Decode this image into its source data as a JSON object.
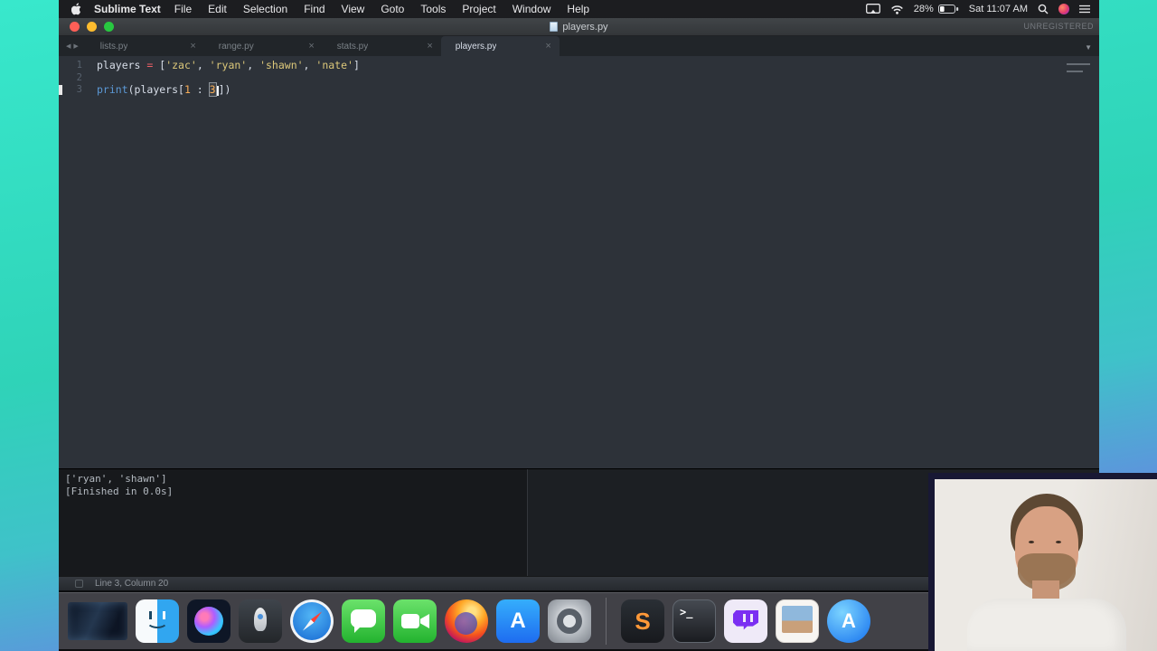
{
  "menu_bar": {
    "app_name": "Sublime Text",
    "items": [
      "File",
      "Edit",
      "Selection",
      "Find",
      "View",
      "Goto",
      "Tools",
      "Project",
      "Window",
      "Help"
    ],
    "battery": "28%",
    "datetime": "Sat 11:07 AM"
  },
  "window": {
    "title": "players.py",
    "registration": "UNREGISTERED",
    "tab_close_glyph": "×",
    "tab_nav_back": "◀",
    "tab_nav_forward": "▶",
    "tab_overflow_glyph": "▼",
    "tabs": [
      {
        "label": "lists.py",
        "active": false
      },
      {
        "label": "range.py",
        "active": false
      },
      {
        "label": "stats.py",
        "active": false
      },
      {
        "label": "players.py",
        "active": true
      }
    ]
  },
  "editor": {
    "lines": [
      {
        "num": "1",
        "caret": false,
        "segments": [
          {
            "t": "players ",
            "c": "fg"
          },
          {
            "t": "=",
            "c": "kw"
          },
          {
            "t": " [",
            "c": "fg"
          },
          {
            "t": "'zac'",
            "c": "str"
          },
          {
            "t": ", ",
            "c": "fg"
          },
          {
            "t": "'ryan'",
            "c": "str"
          },
          {
            "t": ", ",
            "c": "fg"
          },
          {
            "t": "'shawn'",
            "c": "str"
          },
          {
            "t": ", ",
            "c": "fg"
          },
          {
            "t": "'nate'",
            "c": "str"
          },
          {
            "t": "]",
            "c": "fg"
          }
        ]
      },
      {
        "num": "2",
        "caret": false,
        "segments": []
      },
      {
        "num": "3",
        "caret": true,
        "segments": [
          {
            "t": "print",
            "c": "fn"
          },
          {
            "t": "(players[",
            "c": "fg"
          },
          {
            "t": "1",
            "c": "num"
          },
          {
            "t": " : ",
            "c": "fg"
          },
          {
            "t": "3",
            "c": "num sel"
          },
          {
            "caret": true
          },
          {
            "t": "])",
            "c": "fg"
          }
        ]
      }
    ]
  },
  "console": {
    "lines": [
      "['ryan', 'shawn']",
      "[Finished in 0.0s]"
    ]
  },
  "status_bar": {
    "position": "Line 3, Column 20"
  },
  "dock": {
    "items": [
      {
        "id": "thumb",
        "name": "minimized-window-thumbnail"
      },
      {
        "id": "finder",
        "name": "finder-icon"
      },
      {
        "id": "siri",
        "name": "siri-icon"
      },
      {
        "id": "launchpad",
        "name": "launchpad-icon"
      },
      {
        "id": "safari",
        "name": "safari-icon"
      },
      {
        "id": "messages",
        "name": "messages-icon"
      },
      {
        "id": "facetime",
        "name": "facetime-icon"
      },
      {
        "id": "firefox",
        "name": "firefox-icon"
      },
      {
        "id": "appstore",
        "name": "app-store-icon",
        "glyph": "A"
      },
      {
        "id": "syspref",
        "name": "system-preferences-icon"
      },
      {
        "id": "separator",
        "name": "dock-separator"
      },
      {
        "id": "sublime",
        "name": "sublime-text-icon",
        "glyph": "S"
      },
      {
        "id": "terminal",
        "name": "terminal-icon",
        "glyph": ">_"
      },
      {
        "id": "twitch",
        "name": "twitch-icon"
      },
      {
        "id": "photo",
        "name": "photo-file-icon"
      },
      {
        "id": "bluecircle",
        "name": "app-download-icon",
        "glyph": "A"
      }
    ]
  },
  "colors": {
    "wallpaper_teal": "#38e8cc",
    "wallpaper_purple": "#8a55f0",
    "editor_bg": "#2d3239",
    "console_bg": "#17191c",
    "syntax_string": "#dcc87a",
    "syntax_keyword": "#ec5f67",
    "syntax_function": "#5c99d6",
    "syntax_number": "#f9ae58",
    "traffic_red": "#ff5f57",
    "traffic_yellow": "#febc2e",
    "traffic_green": "#28c840"
  }
}
